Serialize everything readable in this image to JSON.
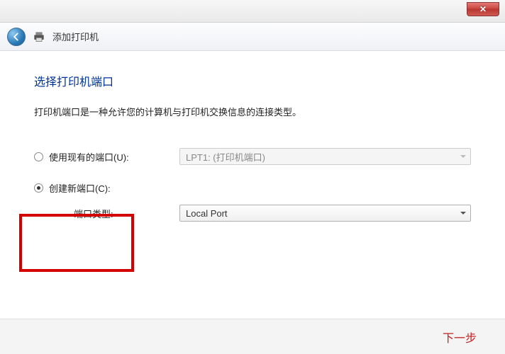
{
  "titlebar": {
    "close_glyph": "✕"
  },
  "header": {
    "title": "添加打印机"
  },
  "page": {
    "heading": "选择打印机端口",
    "description": "打印机端口是一种允许您的计算机与打印机交换信息的连接类型。"
  },
  "options": {
    "useExisting": {
      "label": "使用现有的端口(U):",
      "value": "LPT1: (打印机端口)",
      "checked": false,
      "enabled": false
    },
    "createNew": {
      "label": "创建新端口(C):",
      "checked": true,
      "typeLabel": "端口类型:",
      "value": "Local Port"
    }
  },
  "footer": {
    "next": "下一步"
  }
}
